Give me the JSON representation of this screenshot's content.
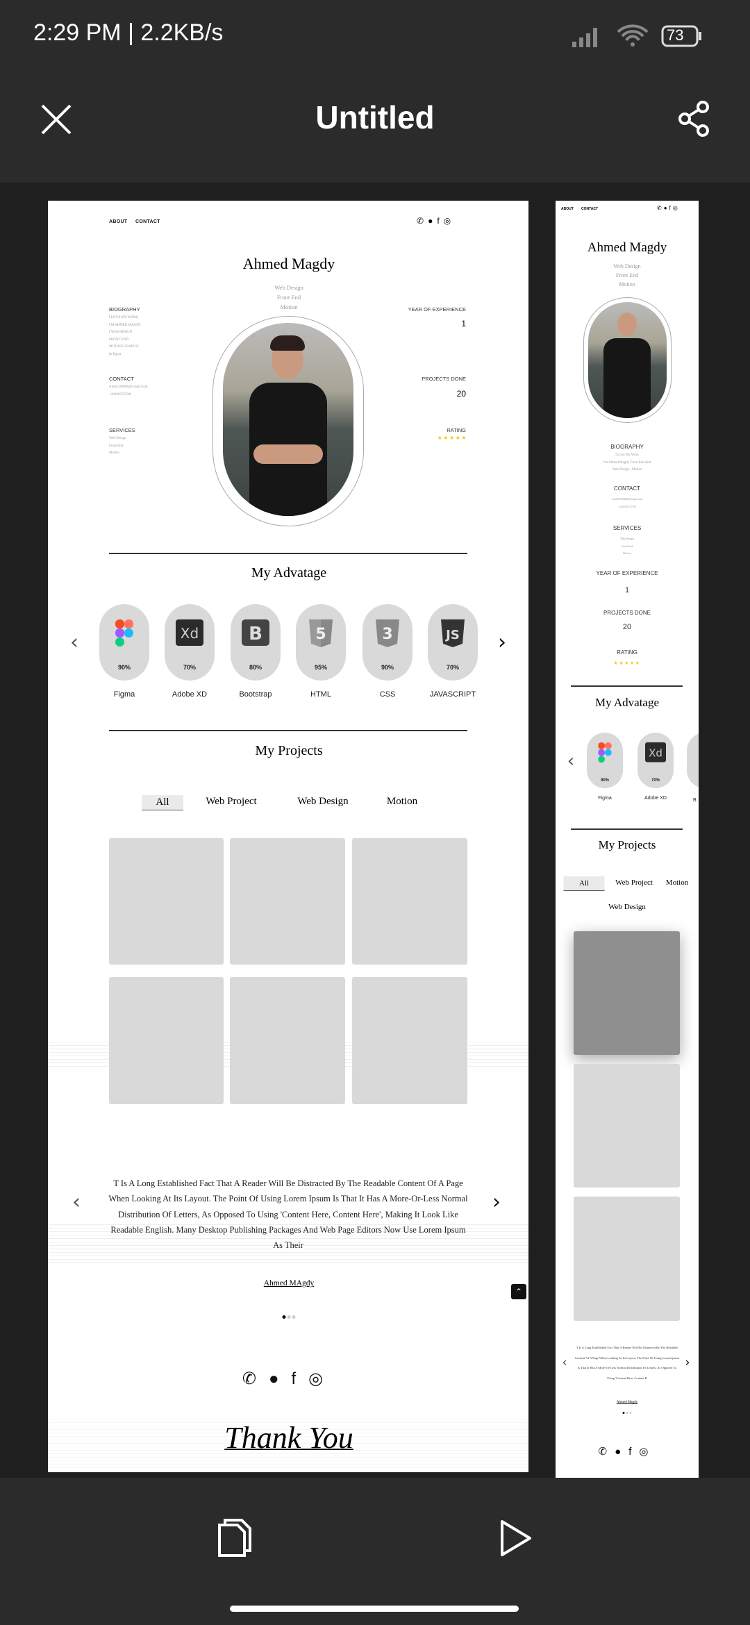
{
  "status_bar": {
    "time": "2:29 PM | 2.2KB/s",
    "battery": "73"
  },
  "header": {
    "title": "Untitled",
    "close_icon": "close-icon",
    "share_icon": "share-icon"
  },
  "site": {
    "nav": [
      "ABOUT",
      "CONTACT"
    ],
    "social_icons": [
      "whatsapp-icon",
      "github-icon",
      "facebook-icon",
      "instagram-icon"
    ],
    "name": "Ahmed Magdy",
    "roles": [
      "Web Design",
      "Front End",
      "Motion"
    ],
    "biography": {
      "title": "BIOGRAPHY",
      "items": [
        "I LOVE MY WORK",
        "I'M AHMED MAGDY",
        "I WEB DESIGN",
        "FRONT END",
        "MOTION GRAPGIC",
        "In Egypt"
      ],
      "mobile_items": [
        "I Love My Work",
        "I'm Ahmed Magdy Front End And",
        "Web Design , Motion"
      ]
    },
    "contact": {
      "title": "CONTACT",
      "items": [
        "Am65329080@Gmail.Com",
        "+201087237O8"
      ]
    },
    "services": {
      "title": "SERVICES",
      "items": [
        "Web Design",
        "Front End",
        "Motion"
      ]
    },
    "stats": {
      "experience_label": "YEAR OF EXPERIENCE",
      "experience": "1",
      "projects_label": "PROJECTS DONE",
      "projects": "20",
      "rating_label": "RATING",
      "rating": 5,
      "stars": "★★★★★"
    },
    "advantage": {
      "title": "My Advatage",
      "skills": [
        {
          "name": "Figma",
          "percent": "90%"
        },
        {
          "name": "Adobe XD",
          "percent": "70%"
        },
        {
          "name": "Bootstrap",
          "percent": "80%"
        },
        {
          "name": "HTML",
          "percent": "95%"
        },
        {
          "name": "CSS",
          "percent": "90%"
        },
        {
          "name": "JAVASCRIPT",
          "percent": "70%"
        }
      ],
      "b_partial": "B"
    },
    "projects": {
      "title": "My Projects",
      "tabs": [
        "All",
        "Web Project",
        "Web Design",
        "Motion"
      ]
    },
    "testimonial": {
      "text": "T Is A Long Established Fact That A Reader Will Be Distracted By The Readable Content Of A Page When Looking At Its Layout. The Point Of Using Lorem Ipsum Is That It Has A More-Or-Less Normal Distribution Of Letters, As Opposed To Using 'Content Here, Content Here', Making It Look Like Readable English. Many Desktop Publishing Packages And Web Page Editors Now Use Lorem Ipsum As Their",
      "mobile_text": "T Is A Long Established Fact That A Reader Will Be Distracted By The Readable Content Of A Page When Looking At Its Layout. The Point Of Using Lorem Ipsum Is That It Has A More-Or-Less Normal Distribution Of Letters, As Opposed To Using 'Content Here, Content R",
      "author": "Ahmed MAgdy",
      "mobile_author": "Ahmed Magdy"
    },
    "footer": {
      "thank_you": "Thank You"
    }
  },
  "bottom_bar": {
    "copy_icon": "copy-icon",
    "play_icon": "play-icon"
  },
  "colors": {
    "bar": "#2b2b2b",
    "canvas": "#1f1f1f",
    "card": "#d9d9d9",
    "star": "#f5c518"
  }
}
